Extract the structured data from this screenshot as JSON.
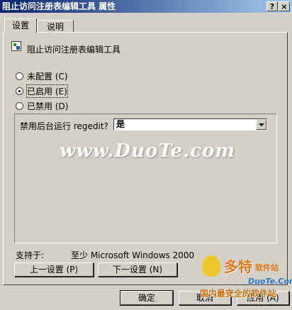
{
  "window": {
    "title": "阻止访问注册表编辑工具 属性",
    "help_button": "?",
    "close_button": "×"
  },
  "tabs": [
    {
      "label": "设置",
      "selected": true
    },
    {
      "label": "说明",
      "selected": false
    }
  ],
  "policy": {
    "name": "阻止访问注册表编辑工具",
    "icon": "policy-setting-icon"
  },
  "options": {
    "not_configured": "未配置 (C)",
    "enabled": "已启用 (E)",
    "disabled": "已禁用 (D)",
    "selected": "enabled"
  },
  "setting": {
    "label": "禁用后台运行 regedit?",
    "value": "是"
  },
  "supported": {
    "label": "支持于:",
    "value": "至少 Microsoft Windows 2000"
  },
  "nav": {
    "prev": "上一设置 (P)",
    "next": "下一设置 (N)"
  },
  "buttons": {
    "ok": "确定",
    "cancel": "取消",
    "apply": "应用 (A)"
  },
  "watermarks": {
    "center": "www.DuoTe.com",
    "logo": "多特",
    "logo_sub": "软件站",
    "url": "DuoTe.Com",
    "slogan": "国内最安全的软件站"
  },
  "colors": {
    "titlebar_start": "#0a246a",
    "titlebar_end": "#a6caf0",
    "face": "#d4d0c8"
  }
}
